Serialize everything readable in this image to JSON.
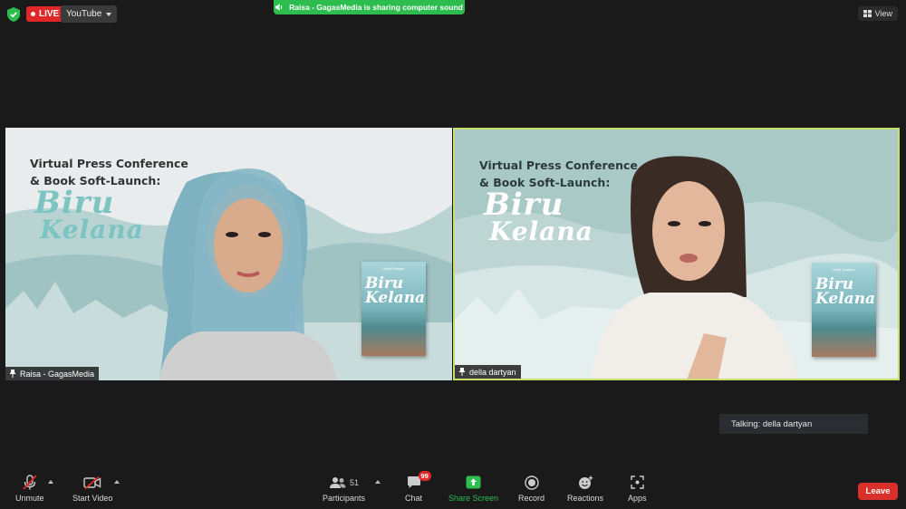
{
  "topbar": {
    "live_label": "LIVE",
    "stream_target": "YouTube",
    "share_banner": "Raisa - GagasMedia is sharing computer sound",
    "view_label": "View"
  },
  "slide": {
    "title_line1": "Virtual Press Conference",
    "title_line2": "& Book Soft-Launch:",
    "book_line1": "Biru",
    "book_line2": "Kelana",
    "cover_author": "Della Dartyan",
    "cover_title1": "Biru",
    "cover_title2": "Kelana"
  },
  "participants": [
    {
      "name": "Raisa - GagasMedia"
    },
    {
      "name": "della dartyan"
    }
  ],
  "talking": "Talking: della dartyan",
  "toolbar": {
    "unmute": "Unmute",
    "start_video": "Start Video",
    "participants": "Participants",
    "participant_count": "51",
    "chat": "Chat",
    "chat_badge": "99",
    "share_screen": "Share Screen",
    "record": "Record",
    "reactions": "Reactions",
    "apps": "Apps",
    "leave": "Leave"
  },
  "colors": {
    "live": "#e02828",
    "share_green": "#2dbd4e",
    "speaker_border": "#c6de6a",
    "leave": "#d9302b"
  }
}
